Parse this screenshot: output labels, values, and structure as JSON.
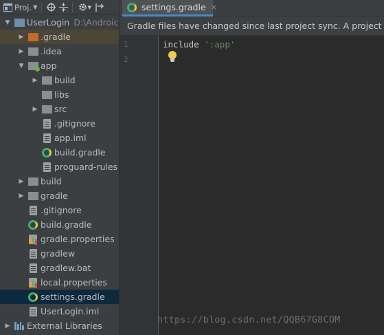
{
  "toolbar": {
    "view_label": "Proj.",
    "view_dropdown_icon": "caret-down-icon",
    "icons": [
      "target-icon",
      "collapse-icon",
      "gear-icon",
      "pin-icon"
    ]
  },
  "tree": [
    {
      "indent": 0,
      "arrow": "expanded",
      "icon": "module-folder",
      "label": "UserLogin",
      "extra": "D:\\Androic",
      "state": ""
    },
    {
      "indent": 1,
      "arrow": "collapsed",
      "icon": "folder-orange",
      "label": ".gradle",
      "extra": "",
      "state": "sel-light"
    },
    {
      "indent": 1,
      "arrow": "collapsed",
      "icon": "folder-grey",
      "label": ".idea",
      "extra": "",
      "state": ""
    },
    {
      "indent": 1,
      "arrow": "expanded",
      "icon": "folder-app",
      "label": "app",
      "extra": "",
      "state": ""
    },
    {
      "indent": 2,
      "arrow": "collapsed",
      "icon": "folder-grey",
      "label": "build",
      "extra": "",
      "state": ""
    },
    {
      "indent": 2,
      "arrow": "none",
      "icon": "folder-grey",
      "label": "libs",
      "extra": "",
      "state": ""
    },
    {
      "indent": 2,
      "arrow": "collapsed",
      "icon": "folder-grey",
      "label": "src",
      "extra": "",
      "state": ""
    },
    {
      "indent": 2,
      "arrow": "none",
      "icon": "file",
      "label": ".gitignore",
      "extra": "",
      "state": ""
    },
    {
      "indent": 2,
      "arrow": "none",
      "icon": "file",
      "label": "app.iml",
      "extra": "",
      "state": ""
    },
    {
      "indent": 2,
      "arrow": "none",
      "icon": "gradle",
      "label": "build.gradle",
      "extra": "",
      "state": ""
    },
    {
      "indent": 2,
      "arrow": "none",
      "icon": "file",
      "label": "proguard-rules",
      "extra": "",
      "state": ""
    },
    {
      "indent": 1,
      "arrow": "collapsed",
      "icon": "folder-grey",
      "label": "build",
      "extra": "",
      "state": ""
    },
    {
      "indent": 1,
      "arrow": "collapsed",
      "icon": "folder-grey",
      "label": "gradle",
      "extra": "",
      "state": ""
    },
    {
      "indent": 1,
      "arrow": "none",
      "icon": "file",
      "label": ".gitignore",
      "extra": "",
      "state": ""
    },
    {
      "indent": 1,
      "arrow": "none",
      "icon": "gradle",
      "label": "build.gradle",
      "extra": "",
      "state": ""
    },
    {
      "indent": 1,
      "arrow": "none",
      "icon": "properties",
      "label": "gradle.properties",
      "extra": "",
      "state": ""
    },
    {
      "indent": 1,
      "arrow": "none",
      "icon": "file",
      "label": "gradlew",
      "extra": "",
      "state": ""
    },
    {
      "indent": 1,
      "arrow": "none",
      "icon": "file",
      "label": "gradlew.bat",
      "extra": "",
      "state": ""
    },
    {
      "indent": 1,
      "arrow": "none",
      "icon": "properties",
      "label": "local.properties",
      "extra": "",
      "state": ""
    },
    {
      "indent": 1,
      "arrow": "none",
      "icon": "gradle",
      "label": "settings.gradle",
      "extra": "",
      "state": "sel"
    },
    {
      "indent": 1,
      "arrow": "none",
      "icon": "file",
      "label": "UserLogin.iml",
      "extra": "",
      "state": ""
    },
    {
      "indent": 0,
      "arrow": "collapsed",
      "icon": "libraries",
      "label": "External Libraries",
      "extra": "",
      "state": ""
    }
  ],
  "editor": {
    "tab_label": "settings.gradle",
    "tab_close": "×",
    "notice": "Gradle files have changed since last project sync. A project sync",
    "lines": [
      {
        "number": "1",
        "keyword": "include",
        "string": "':app'"
      },
      {
        "number": "2",
        "keyword": "",
        "string": ""
      }
    ]
  },
  "watermark": "https://blog.csdn.net/QQB67G8COM",
  "colors": {
    "accent": "#4a88c7",
    "selection": "#0d293e",
    "string": "#6a8759",
    "gradle": "#3bb371"
  }
}
